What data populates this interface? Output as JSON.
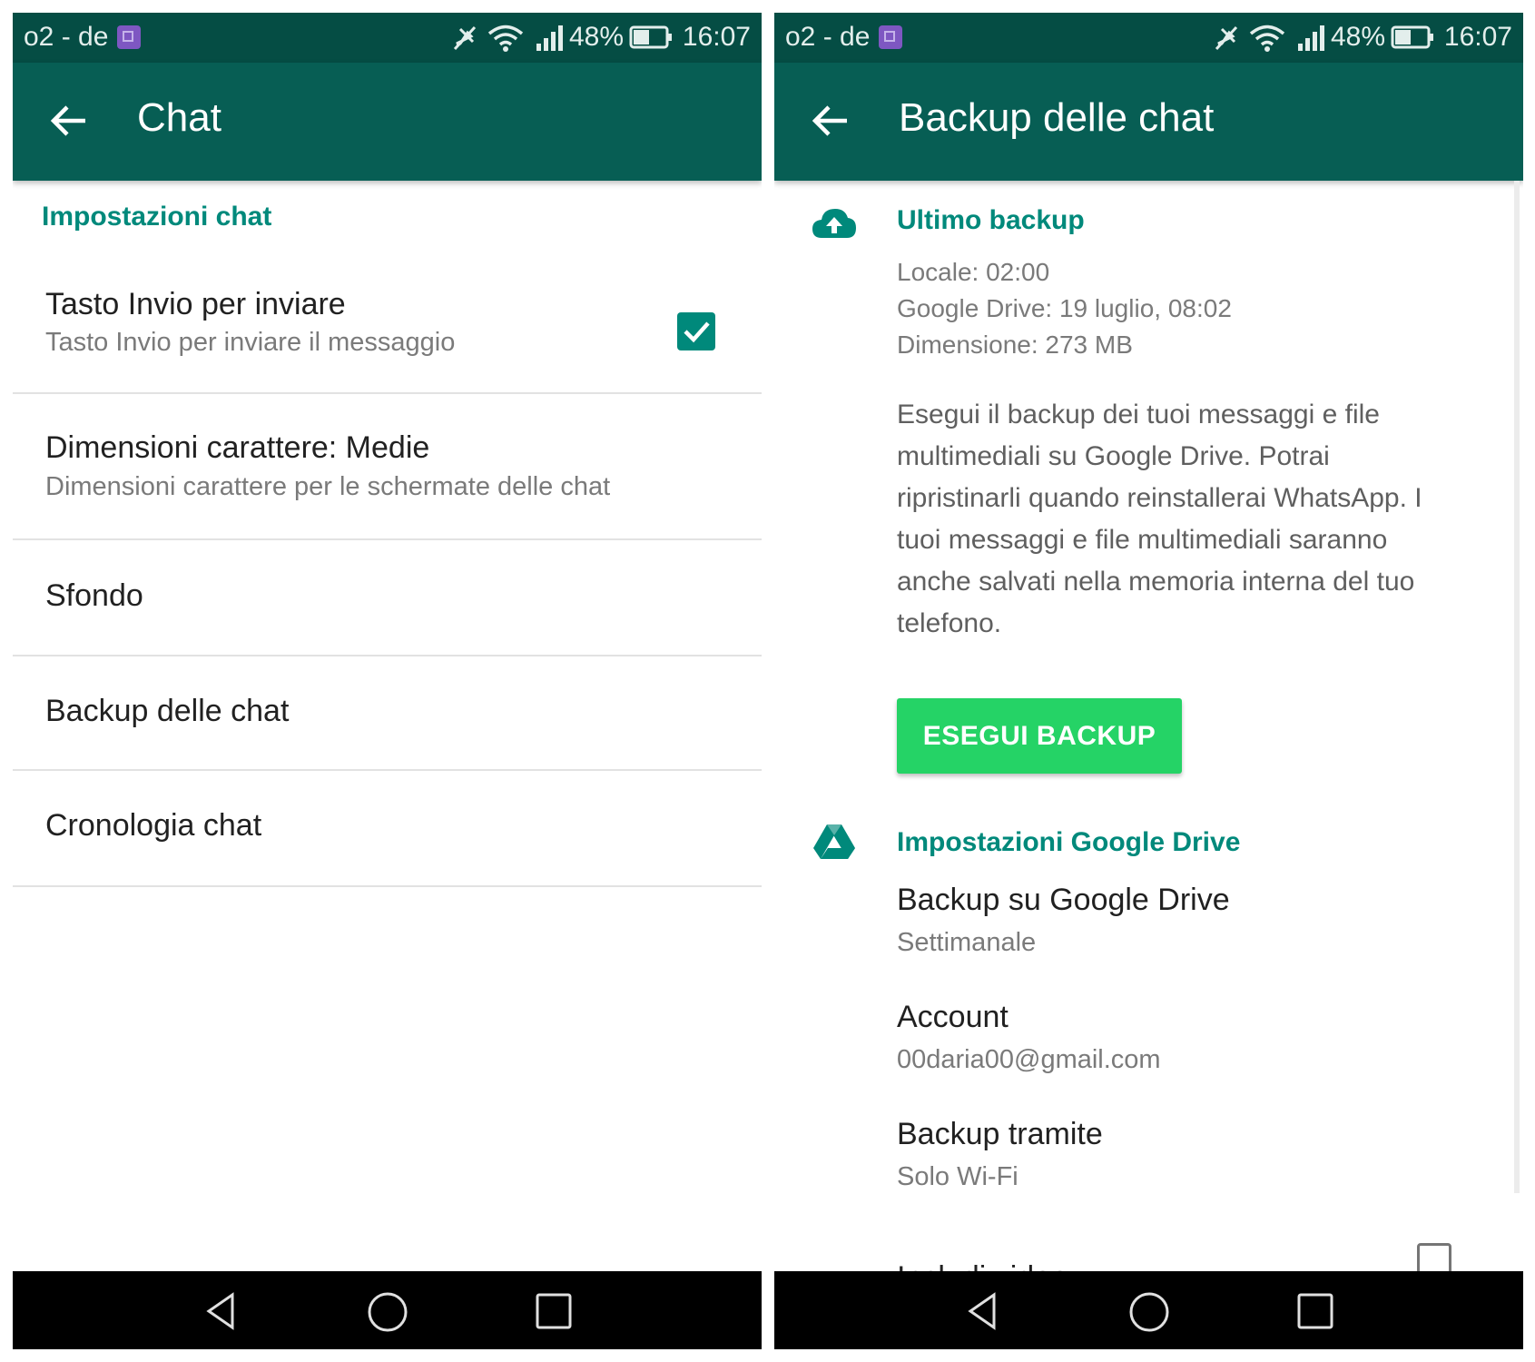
{
  "status_bar": {
    "carrier": "o2 - de",
    "battery": "48%",
    "time": "16:07"
  },
  "left_screen": {
    "title": "Chat",
    "section_header": "Impostazioni chat",
    "enter_to_send": {
      "title": "Tasto Invio per inviare",
      "subtitle": "Tasto Invio per inviare il messaggio",
      "checked": true
    },
    "font_size": {
      "title": "Dimensioni carattere: Medie",
      "subtitle": "Dimensioni carattere per le schermate delle chat"
    },
    "wallpaper": {
      "title": "Sfondo"
    },
    "chat_backup": {
      "title": "Backup delle chat"
    },
    "chat_history": {
      "title": "Cronologia chat"
    }
  },
  "right_screen": {
    "title": "Backup delle chat",
    "last_backup": {
      "header": "Ultimo backup",
      "local": "Locale: 02:00",
      "google_drive": "Google Drive: 19 luglio, 08:02",
      "size": "Dimensione: 273 MB"
    },
    "description": "Esegui il backup dei tuoi messaggi e file multimediali su Google Drive. Potrai ripristinarli quando reinstallerai WhatsApp. I tuoi messaggi e file multimediali saranno anche salvati nella memoria interna del tuo telefono.",
    "backup_button": "ESEGUI BACKUP",
    "drive_settings": {
      "header": "Impostazioni Google Drive",
      "backup_to_drive": {
        "title": "Backup su Google Drive",
        "value": "Settimanale"
      },
      "account": {
        "title": "Account",
        "value": "00daria00@gmail.com"
      },
      "backup_over": {
        "title": "Backup tramite",
        "value": "Solo Wi-Fi"
      },
      "include_video": {
        "title": "Includi video",
        "checked": false
      }
    }
  },
  "colors": {
    "status_bar": "#054d44",
    "app_bar": "#075e54",
    "accent": "#00897b",
    "button": "#25d366",
    "nav_bar": "#000000"
  },
  "icons": [
    "back-arrow-icon",
    "mute-icon",
    "wifi-icon",
    "signal-icon",
    "battery-icon",
    "cloud-upload-icon",
    "google-drive-icon",
    "nav-back-icon",
    "nav-home-icon",
    "nav-recents-icon",
    "checkbox-icon"
  ]
}
